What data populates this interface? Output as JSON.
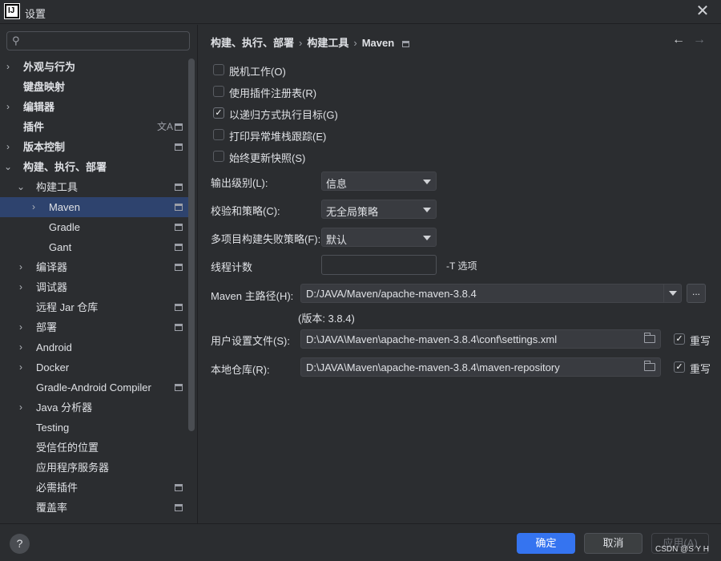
{
  "window": {
    "title": "设置",
    "close_glyph": "✕",
    "icon_text": "IJ"
  },
  "sidebar": {
    "search_placeholder": "",
    "items": [
      {
        "label": "外观与行为",
        "expand": "›",
        "bold": true
      },
      {
        "label": "键盘映射",
        "bold": true
      },
      {
        "label": "编辑器",
        "expand": "›",
        "bold": true
      },
      {
        "label": "插件",
        "bold": true,
        "icons": [
          "translate-icon",
          "settings-scope-icon"
        ],
        "translate_glyph": "文A"
      },
      {
        "label": "版本控制",
        "expand": "›",
        "bold": true,
        "icons": [
          "settings-scope-icon"
        ]
      },
      {
        "label": "构建、执行、部署",
        "expand": "⌄",
        "bold": true
      },
      {
        "label": "构建工具",
        "expand": "⌄",
        "icons": [
          "settings-scope-icon"
        ]
      },
      {
        "label": "Maven",
        "expand": "›",
        "selected": true,
        "icons": [
          "settings-scope-icon"
        ]
      },
      {
        "label": "Gradle",
        "icons": [
          "settings-scope-icon"
        ]
      },
      {
        "label": "Gant",
        "icons": [
          "settings-scope-icon"
        ]
      },
      {
        "label": "编译器",
        "expand": "›",
        "icons": [
          "settings-scope-icon"
        ]
      },
      {
        "label": "调试器",
        "expand": "›"
      },
      {
        "label": "远程 Jar 仓库",
        "icons": [
          "settings-scope-icon"
        ]
      },
      {
        "label": "部署",
        "expand": "›",
        "icons": [
          "settings-scope-icon"
        ]
      },
      {
        "label": "Android",
        "expand": "›"
      },
      {
        "label": "Docker",
        "expand": "›"
      },
      {
        "label": "Gradle-Android Compiler",
        "icons": [
          "settings-scope-icon"
        ]
      },
      {
        "label": "Java 分析器",
        "expand": "›"
      },
      {
        "label": "Testing"
      },
      {
        "label": "受信任的位置"
      },
      {
        "label": "应用程序服务器"
      },
      {
        "label": "必需插件",
        "icons": [
          "settings-scope-icon"
        ]
      },
      {
        "label": "覆盖率",
        "icons": [
          "settings-scope-icon"
        ]
      }
    ]
  },
  "breadcrumb": [
    "构建、执行、部署",
    "构建工具",
    "Maven"
  ],
  "breadcrumb_sep": "›",
  "nav": {
    "back": "←",
    "forward": "→"
  },
  "checkboxes": [
    {
      "label": "脱机工作(O)",
      "checked": false
    },
    {
      "label": "使用插件注册表(R)",
      "checked": false
    },
    {
      "label": "以递归方式执行目标(G)",
      "checked": true
    },
    {
      "label": "打印异常堆栈跟踪(E)",
      "checked": false
    },
    {
      "label": "始终更新快照(S)",
      "checked": false
    }
  ],
  "check_glyph": "✓",
  "fields": {
    "output_level": {
      "label": "输出级别(L):",
      "value": "信息"
    },
    "checksum_policy": {
      "label": "校验和策略(C):",
      "value": "无全局策略"
    },
    "multiproject_fail": {
      "label": "多项目构建失败策略(F):",
      "value": "默认"
    },
    "thread_count": {
      "label": "线程计数",
      "value": "",
      "suffix": "-T 选项"
    },
    "maven_home": {
      "label": "Maven 主路径(H):",
      "value": "D:/JAVA/Maven/apache-maven-3.8.4",
      "browse": "..."
    },
    "version": "(版本: 3.8.4)",
    "user_settings": {
      "label": "用户设置文件(S):",
      "value": "D:\\JAVA\\Maven\\apache-maven-3.8.4\\conf\\settings.xml",
      "override_label": "重写",
      "override": true
    },
    "local_repo": {
      "label": "本地仓库(R):",
      "value": "D:\\JAVA\\Maven\\apache-maven-3.8.4\\maven-repository",
      "override_label": "重写",
      "override": true
    }
  },
  "footer": {
    "help": "?",
    "ok": "确定",
    "cancel": "取消",
    "apply": "应用(A)"
  },
  "watermark": "CSDN @S Y H",
  "colors": {
    "accent": "#3574f0",
    "selection": "#2e436e",
    "background": "#2b2d30"
  }
}
